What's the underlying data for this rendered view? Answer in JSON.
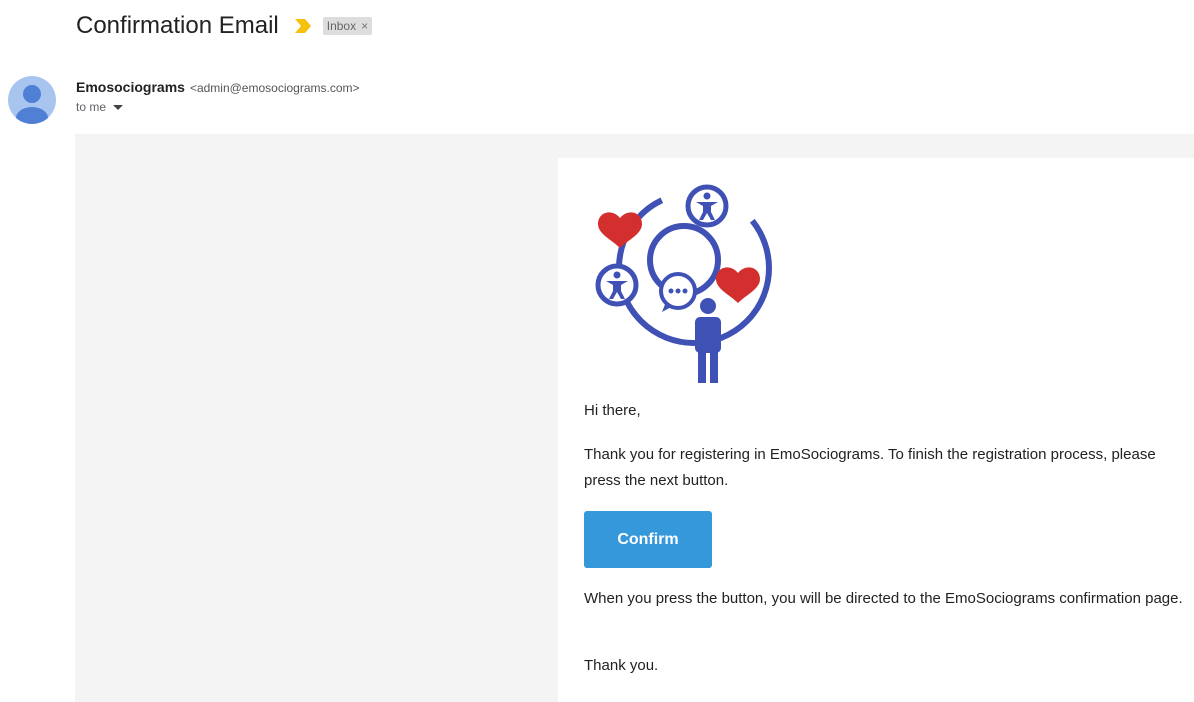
{
  "header": {
    "subject": "Confirmation Email",
    "label": "Inbox",
    "label_close": "×"
  },
  "sender": {
    "name": "Emosociograms",
    "email": "<admin@emosociograms.com>",
    "to": "to me"
  },
  "email_body": {
    "greeting": "Hi there,",
    "paragraph1": "Thank you for registering in EmoSociograms. To finish the registration process, please press the next button.",
    "confirm_label": "Confirm",
    "paragraph2": "When you press the button, you will be directed to the EmoSociograms confirmation page.",
    "thanks": "Thank you."
  },
  "icons": {
    "importance": "importance-marker-icon",
    "avatar": "person-avatar-icon",
    "caret": "chevron-down-icon",
    "logo": "emosociograms-logo"
  },
  "colors": {
    "importance": "#f4c20d",
    "logo_blue": "#3f51b5",
    "logo_red": "#d32f2f",
    "button": "#3498db",
    "avatar_bg": "#a8c5f0",
    "avatar_fg": "#4f80d6"
  }
}
